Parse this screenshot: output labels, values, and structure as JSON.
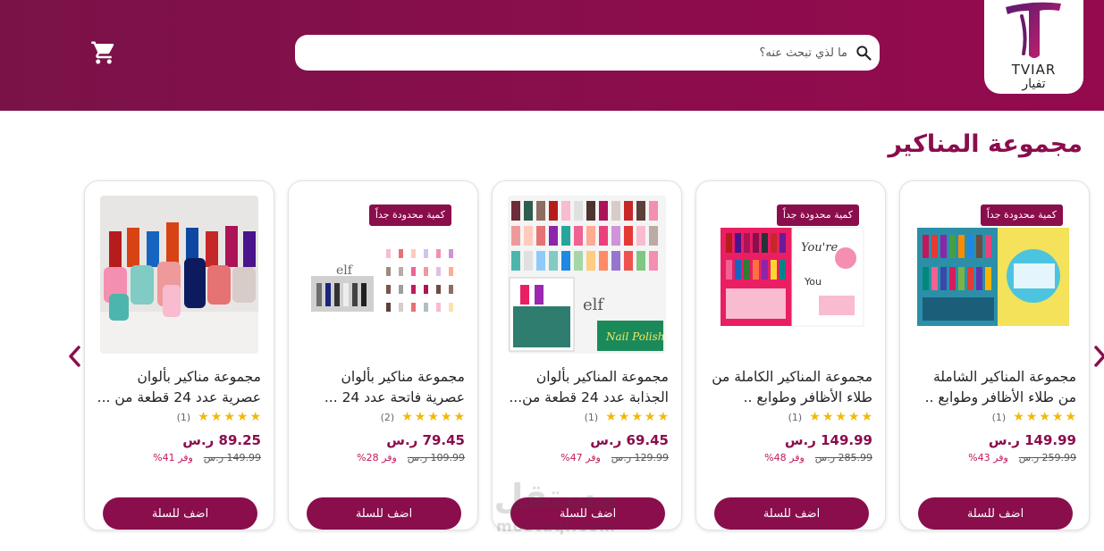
{
  "header": {
    "brand_latin": "TVIAR",
    "brand_arabic": "تفيار",
    "search_placeholder": "ما لذي تبحث عنه؟",
    "cart_icon": "cart-icon",
    "search_icon": "search-icon"
  },
  "section": {
    "title": "مجموعة المناكير"
  },
  "products": [
    {
      "title": "مجموعة المناكير الشاملة من طلاء الأظافر وطوابع ..",
      "badge": "كمية محدودة جداً",
      "rating_count": "(1)",
      "price": "149.99 ر.س",
      "old_price": "259.99 ر.س",
      "saving": "وفر 43%",
      "button": "اضف للسلة",
      "image": "nail-polish-set-teal-box"
    },
    {
      "title": "مجموعة المناكير الكاملة من طلاء الأظافر وطوابع ..",
      "badge": "كمية محدودة جداً",
      "rating_count": "(1)",
      "price": "149.99 ر.س",
      "old_price": "285.99 ر.س",
      "saving": "وفر 48%",
      "button": "اضف للسلة",
      "image": "nail-polish-set-pink-box"
    },
    {
      "title": "مجموعة المناكير بألوان الجذابة عدد 24 قطعة من...",
      "badge": "",
      "rating_count": "(1)",
      "price": "69.45 ر.س",
      "old_price": "129.99 ر.س",
      "saving": "وفر 47%",
      "button": "اضف للسلة",
      "image": "elf-nail-polish-display"
    },
    {
      "title": "مجموعة مناكير بألوان عصرية فاتحة عدد 24 ...",
      "badge": "كمية محدودة جداً",
      "rating_count": "(2)",
      "price": "79.45 ر.س",
      "old_price": "109.99 ر.س",
      "saving": "وفر 28%",
      "button": "اضف للسلة",
      "image": "elf-nail-polish-chart"
    },
    {
      "title": "مجموعة مناكير بألوان عصرية عدد 24 قطعة من ...",
      "badge": "",
      "rating_count": "(1)",
      "price": "89.25 ر.س",
      "old_price": "149.99 ر.س",
      "saving": "وفر 41%",
      "button": "اضف للسلة",
      "image": "nail-polish-bottles-photo"
    }
  ],
  "watermark": {
    "arabic": "مستقل",
    "latin": "mostaql.com"
  },
  "colors": {
    "brand": "#8a0d4c",
    "star": "#f2b80c"
  }
}
